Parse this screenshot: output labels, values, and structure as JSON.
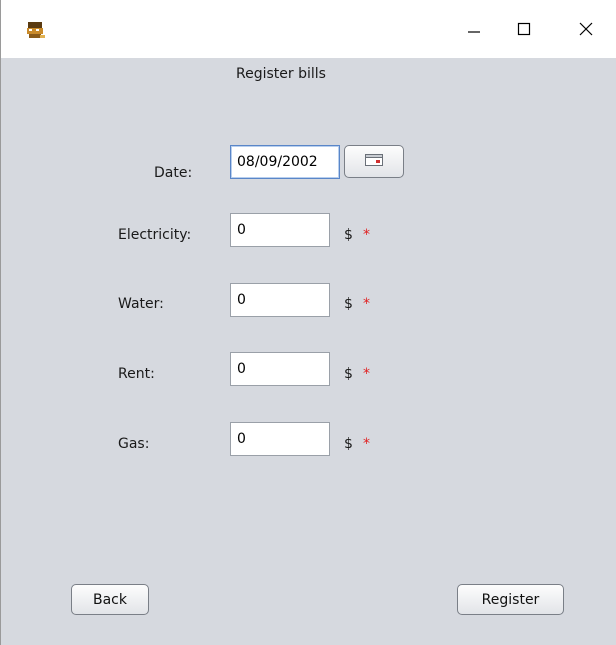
{
  "window": {
    "icons": {
      "app": "cat-app-icon",
      "minimize": "minimize-icon",
      "maximize": "maximize-icon",
      "close": "close-icon"
    }
  },
  "form": {
    "title": "Register bills",
    "date": {
      "label": "Date:",
      "value": "08/09/2002",
      "calendar_icon": "calendar-icon"
    },
    "fields": [
      {
        "label": "Electricity:",
        "value": "0",
        "unit": "$",
        "required_mark": "*"
      },
      {
        "label": "Water:",
        "value": "0",
        "unit": "$",
        "required_mark": "*"
      },
      {
        "label": "Rent:",
        "value": "0",
        "unit": "$",
        "required_mark": "*"
      },
      {
        "label": "Gas:",
        "value": "0",
        "unit": "$",
        "required_mark": "*"
      }
    ]
  },
  "actions": {
    "back_label": "Back",
    "register_label": "Register"
  },
  "colors": {
    "background": "#d6d9df",
    "required": "#e02020",
    "focus_border": "#5a86c8"
  }
}
